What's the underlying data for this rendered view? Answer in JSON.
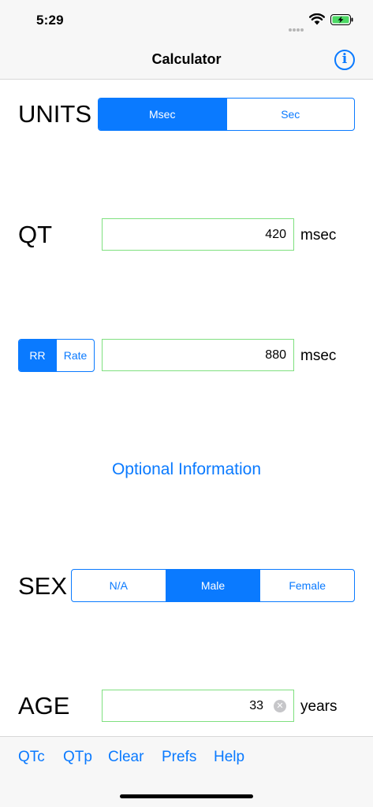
{
  "status_bar": {
    "time": "5:29"
  },
  "nav": {
    "title": "Calculator",
    "info_label": "i"
  },
  "units": {
    "label": "UNITS",
    "options": [
      "Msec",
      "Sec"
    ],
    "selected": "Msec"
  },
  "qt": {
    "label": "QT",
    "value": "420",
    "unit": "msec"
  },
  "rr": {
    "options": [
      "RR",
      "Rate"
    ],
    "selected": "RR",
    "value": "880",
    "unit": "msec"
  },
  "optional": {
    "link": "Optional Information"
  },
  "sex": {
    "label": "SEX",
    "options": [
      "N/A",
      "Male",
      "Female"
    ],
    "selected": "Male"
  },
  "age": {
    "label": "AGE",
    "value": "33",
    "unit": "years"
  },
  "tab_bar": {
    "items": [
      "QTc",
      "QTp",
      "Clear",
      "Prefs",
      "Help"
    ]
  },
  "colors": {
    "accent": "#0a7aff",
    "field_border": "#7fe07f",
    "bar_background": "#f7f7f7"
  }
}
